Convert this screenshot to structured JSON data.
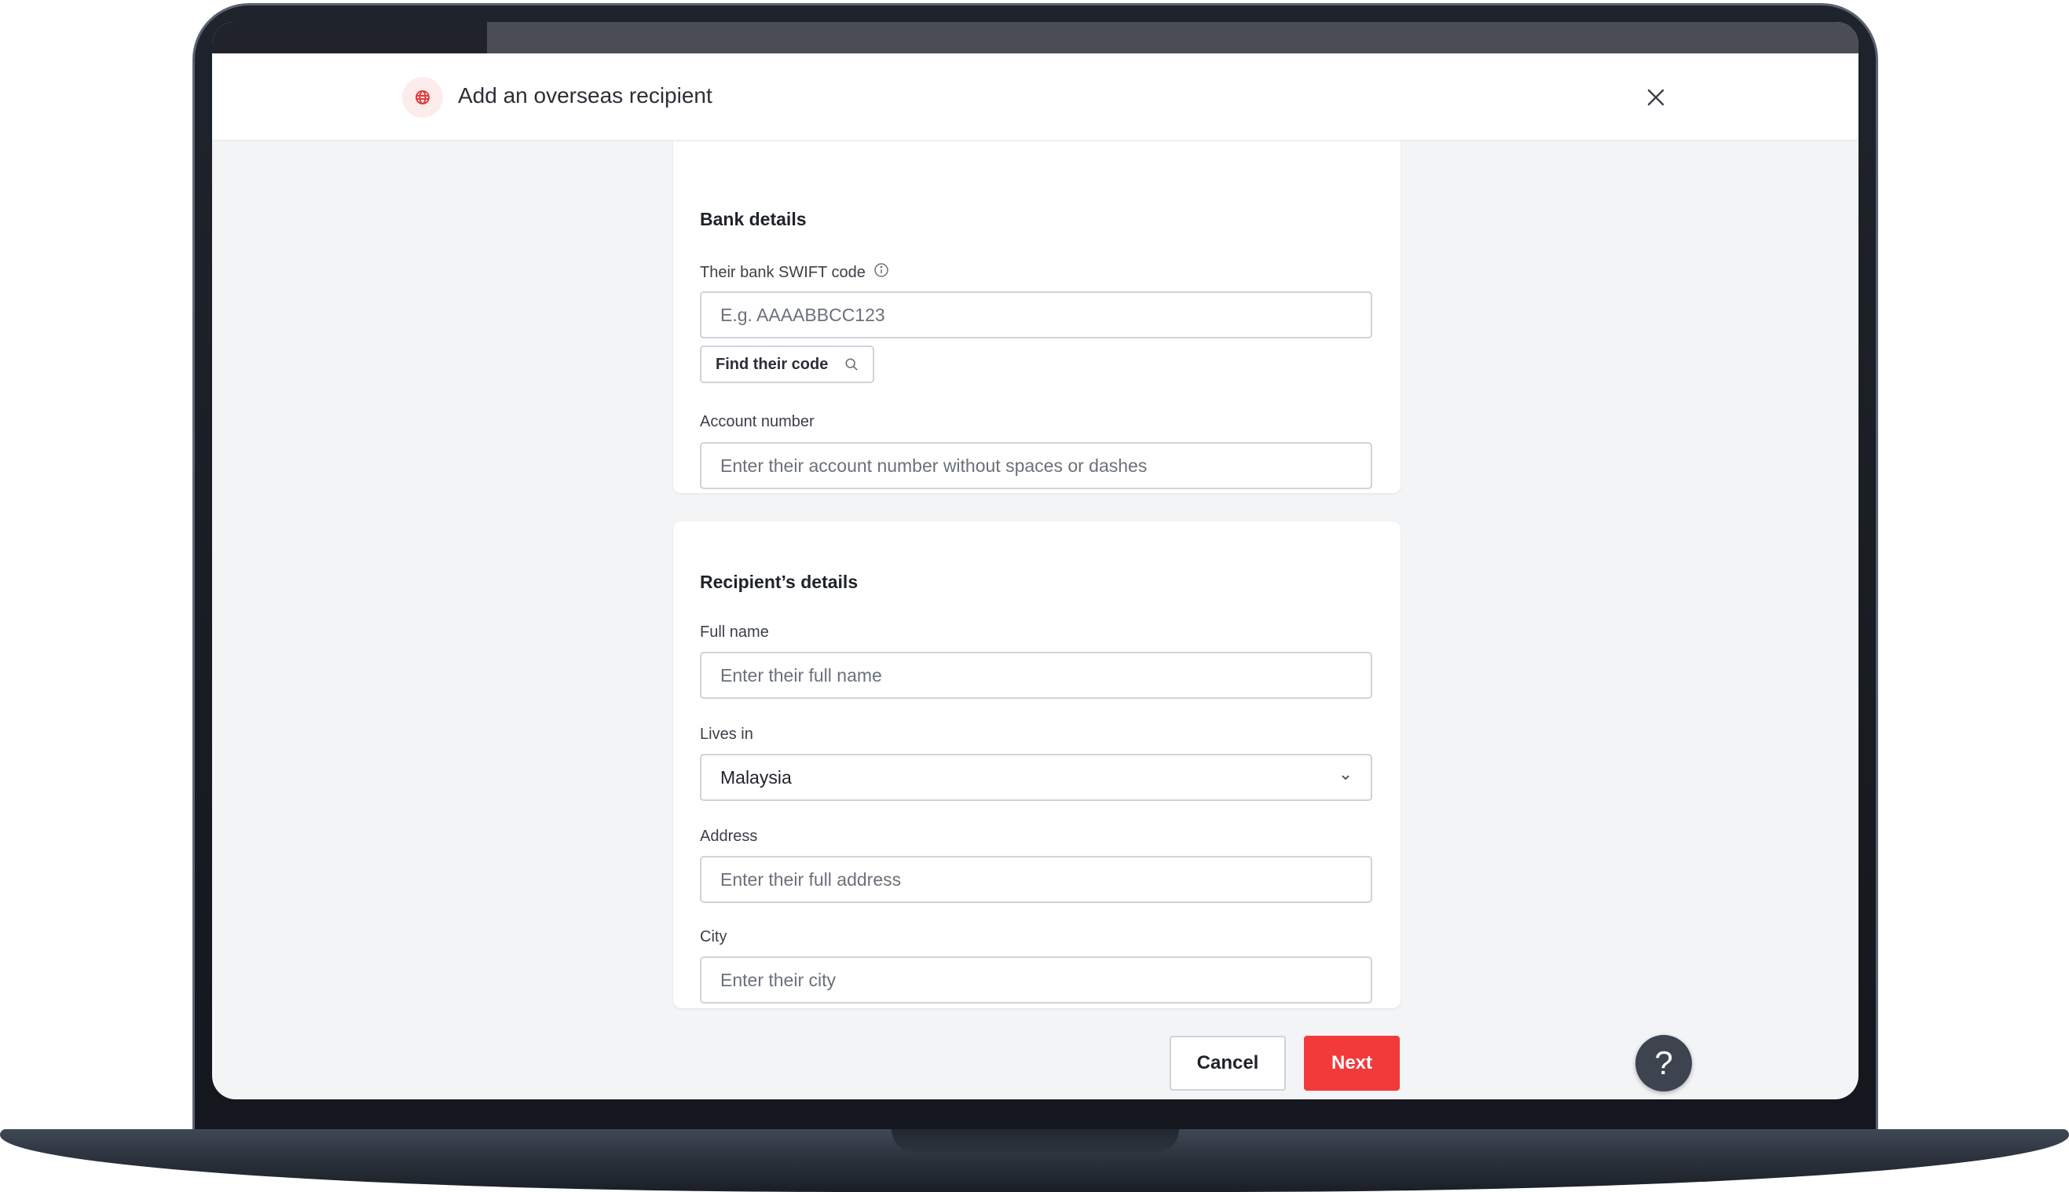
{
  "modal": {
    "title": "Add an overseas recipient",
    "icon": "globe-icon",
    "accent_color": "#f23a3a"
  },
  "bank_details": {
    "section_title": "Bank details",
    "swift": {
      "label": "Their bank SWIFT code",
      "placeholder": "E.g. AAAABBCC123",
      "value": "",
      "info_icon": "info-icon"
    },
    "find_code_label": "Find their code",
    "account_number": {
      "label": "Account number",
      "placeholder": "Enter their account number without spaces or dashes",
      "value": ""
    }
  },
  "recipient_details": {
    "section_title": "Recipient’s details",
    "full_name": {
      "label": "Full name",
      "placeholder": "Enter their full name",
      "value": ""
    },
    "lives_in": {
      "label": "Lives in",
      "value": "Malaysia"
    },
    "address": {
      "label": "Address",
      "placeholder": "Enter their full address",
      "value": ""
    },
    "city": {
      "label": "City",
      "placeholder": "Enter their city",
      "value": ""
    }
  },
  "footer": {
    "cancel_label": "Cancel",
    "next_label": "Next",
    "help_label": "?"
  }
}
